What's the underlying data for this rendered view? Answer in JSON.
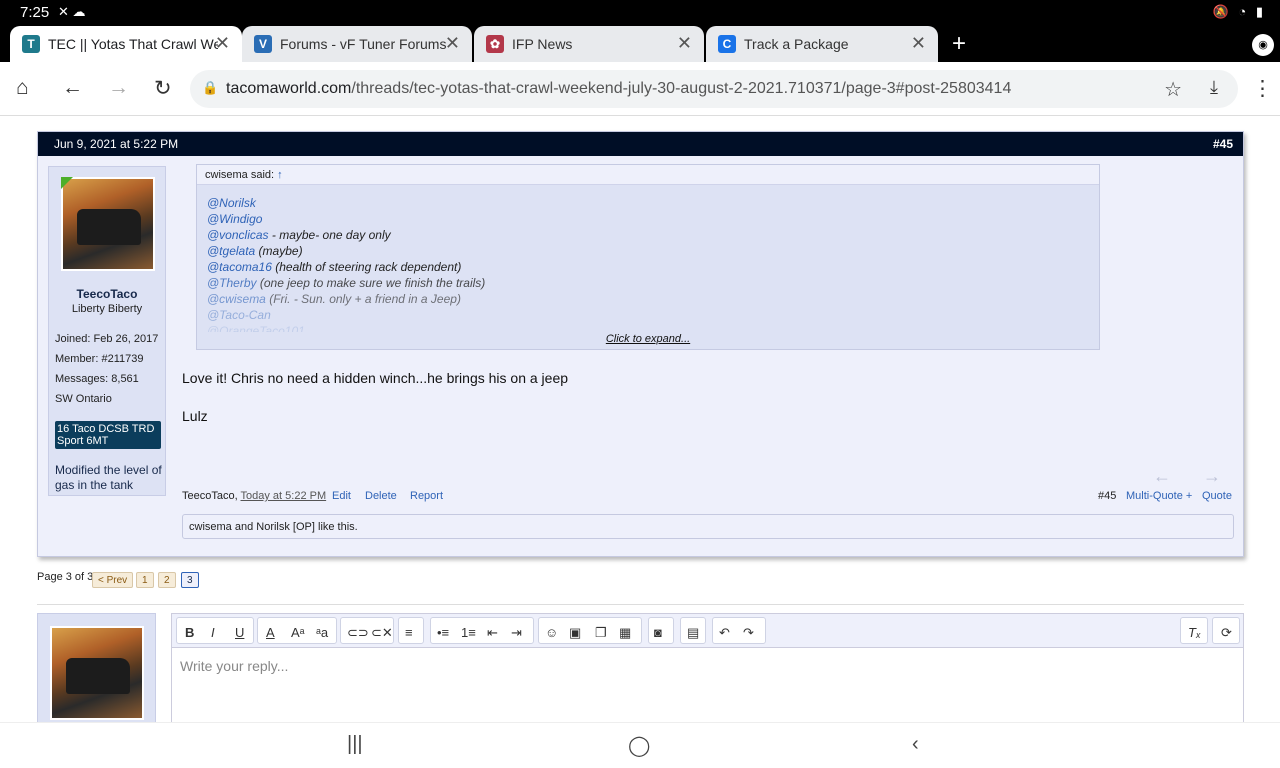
{
  "status": {
    "time": "7:25",
    "left_icons": "✕ ☁",
    "right_icons": "🔕 ◔ ▮"
  },
  "tabs": [
    {
      "title": "TEC || Yotas That Crawl Wee",
      "fav": "T",
      "fav_color": "#1f7a8c"
    },
    {
      "title": "Forums - vF Tuner Forums",
      "fav": "V",
      "fav_color": "#2a6db5"
    },
    {
      "title": "IFP News",
      "fav": "✿",
      "fav_color": "#b3384a"
    },
    {
      "title": "Track a Package",
      "fav": "C",
      "fav_color": "#1a73e8"
    }
  ],
  "toolbar": {
    "new_tab": "+",
    "incognito": "◉"
  },
  "url": {
    "host": "tacomaworld.com",
    "path": "/threads/tec-yotas-that-crawl-weekend-july-30-august-2-2021.710371/page-3#post-25803414"
  },
  "post": {
    "date": "Jun 9, 2021 at 5:22 PM",
    "number": "#45",
    "user": {
      "name": "TeecoTaco",
      "title": "Liberty Biberty",
      "joined_label": "Joined:",
      "joined": "Feb 26, 2017",
      "member_label": "Member:",
      "member": "#211739",
      "messages_label": "Messages:",
      "messages": "8,561",
      "location": "SW Ontario",
      "truck": "16 Taco DCSB TRD Sport 6MT",
      "mod_line1": "Modified the level of",
      "mod_line2": "gas in the tank"
    },
    "quote": {
      "author": "cwisema said:",
      "arrow": "↑",
      "lines": [
        {
          "mention": "@Norilsk",
          "rest": ""
        },
        {
          "mention": "@Windigo",
          "rest": ""
        },
        {
          "mention": "@vonclicas",
          "rest": " - maybe- one day only"
        },
        {
          "mention": "@tgelata",
          "rest": " (maybe)"
        },
        {
          "mention": "@tacoma16",
          "rest": " (health of steering rack dependent)"
        },
        {
          "mention": "@Therby",
          "rest": " (one jeep to make sure we finish the trails)"
        },
        {
          "mention": "@cwisema",
          "rest": " (Fri. - Sun. only + a friend in a Jeep)"
        },
        {
          "mention": "@Taco-Can",
          "rest": ""
        },
        {
          "mention": "@OrangeTaco101",
          "rest": ""
        }
      ],
      "expand": "Click to expand..."
    },
    "message1": "Love it! Chris no need a hidden winch...he brings his on a jeep",
    "message2": "Lulz",
    "footer": {
      "author": "TeecoTaco,",
      "time": "Today at 5:22 PM",
      "edit": "Edit",
      "delete": "Delete",
      "report": "Report",
      "num": "#45",
      "multiquote": "Multi-Quote +",
      "quote": "Quote"
    },
    "likes": {
      "users": "cwisema and Norilsk [OP]",
      "suffix": " like this."
    },
    "nav_prev": "←",
    "nav_next": "→"
  },
  "pagination": {
    "label": "Page 3 of 3",
    "prev": "< Prev",
    "p1": "1",
    "p2": "2",
    "p3": "3"
  },
  "editor": {
    "placeholder": "Write your reply..."
  },
  "navbar": {
    "recents": "|||",
    "home": "◯",
    "back": "‹"
  }
}
